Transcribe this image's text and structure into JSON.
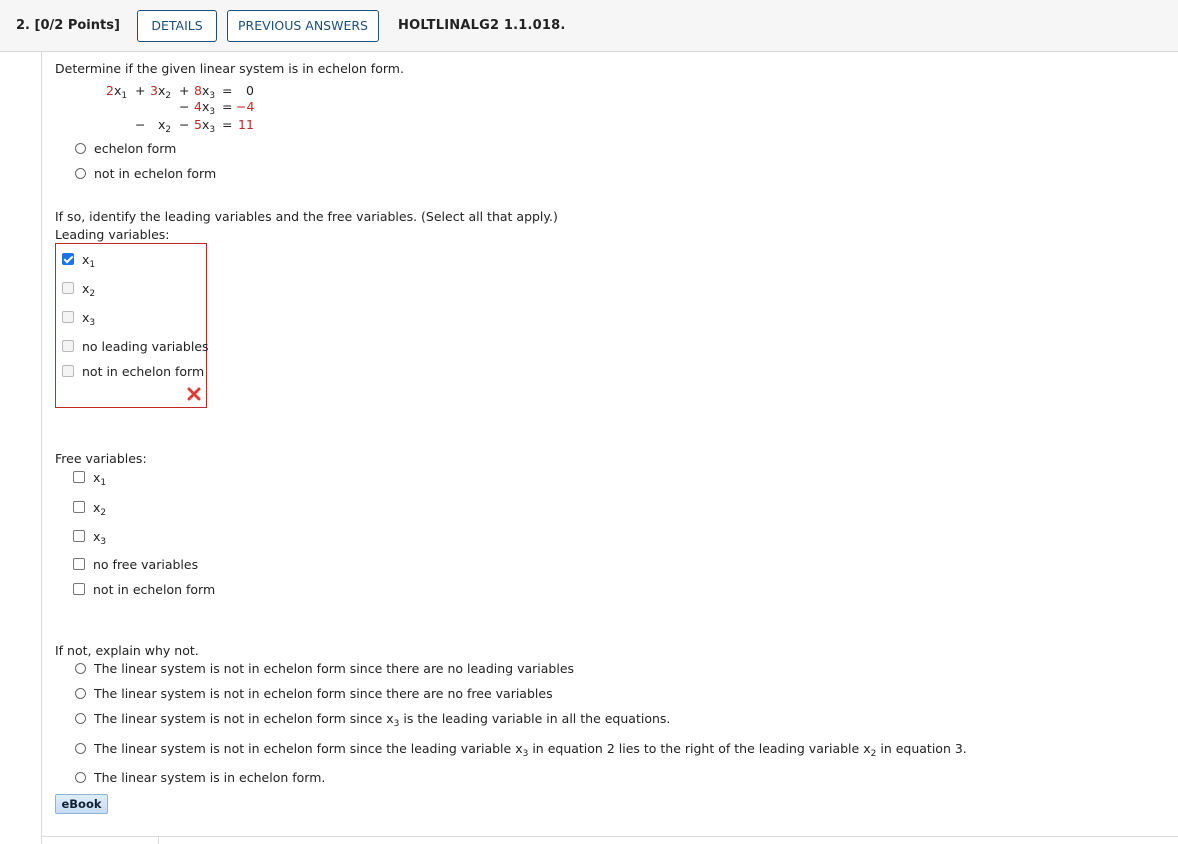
{
  "header": {
    "points": "2. [0/2 Points]",
    "details_label": "DETAILS",
    "previous_answers_label": "PREVIOUS ANSWERS",
    "problem_id": "HOLTLINALG2 1.1.018."
  },
  "question": {
    "prompt": "Determine if the given linear system is in echelon form.",
    "system": {
      "row1": {
        "c1": "2",
        "c2": "3",
        "c3": "8",
        "rhs": "0"
      },
      "row2": {
        "c3": "4",
        "rhs": "−4"
      },
      "row3": {
        "c3": "5",
        "rhs": "11"
      }
    },
    "form_options": [
      "echelon form",
      "not in echelon form"
    ],
    "form_selected": null
  },
  "leading": {
    "instruction": "If so, identify the leading variables and the free variables. (Select all that apply.)",
    "label": "Leading variables:",
    "options": [
      {
        "var": "x",
        "sub": "1",
        "checked": true
      },
      {
        "var": "x",
        "sub": "2",
        "checked": false
      },
      {
        "var": "x",
        "sub": "3",
        "checked": false
      },
      {
        "text": "no leading variables",
        "checked": false
      },
      {
        "text": "not in echelon form",
        "checked": false
      }
    ],
    "status": "incorrect"
  },
  "free": {
    "label": "Free variables:",
    "options": [
      {
        "var": "x",
        "sub": "1",
        "checked": false
      },
      {
        "var": "x",
        "sub": "2",
        "checked": false
      },
      {
        "var": "x",
        "sub": "3",
        "checked": false
      },
      {
        "text": "no free variables",
        "checked": false
      },
      {
        "text": "not in echelon form",
        "checked": false
      }
    ]
  },
  "explain": {
    "label": "If not, explain why not.",
    "opt1": "The linear system is not in echelon form since there are no leading variables",
    "opt2": "The linear system is not in echelon form since there are no free variables",
    "opt3_a": "The linear system is not in echelon form since",
    "opt3_b": "is the leading variable in all the equations.",
    "opt4_a": "The linear system is not in echelon form since the leading variable",
    "opt4_b": "in equation 2 lies to the right of the leading variable",
    "opt4_c": "in equation 3.",
    "opt5": "The linear system is in echelon form.",
    "var": "x",
    "sub2": "2",
    "sub3": "3"
  },
  "ebook_label": "eBook",
  "colors": {
    "accent": "#1c4f7c",
    "error": "#c62828",
    "check": "#1a73e8"
  }
}
